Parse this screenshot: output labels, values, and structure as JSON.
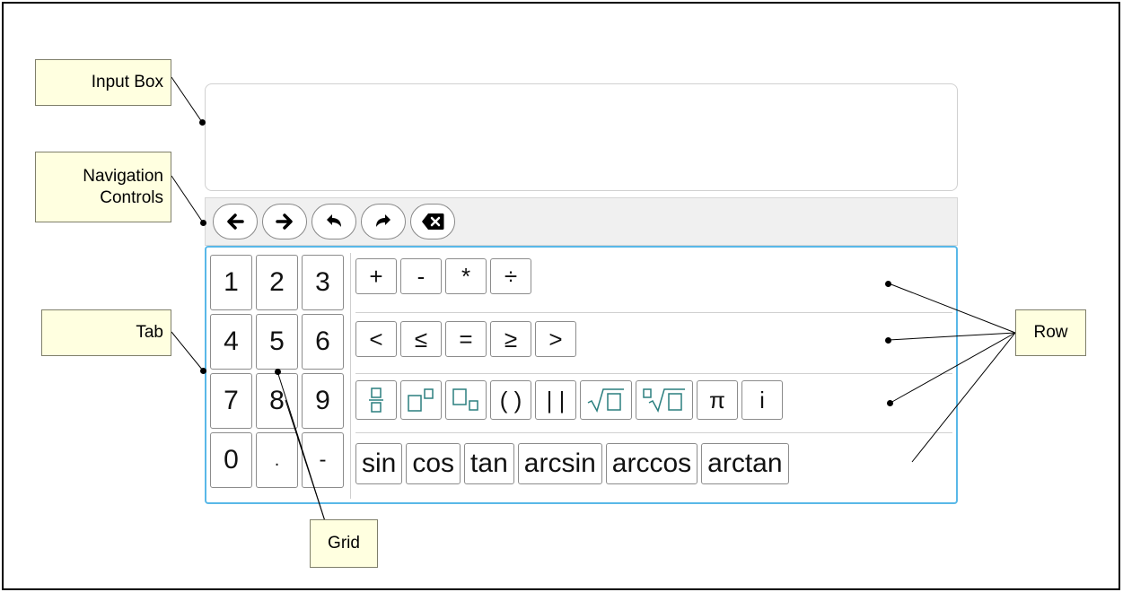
{
  "callouts": {
    "input_box": "Input Box",
    "navigation_line1": "Navigation",
    "navigation_line2": "Controls",
    "tab": "Tab",
    "row": "Row",
    "grid": "Grid"
  },
  "nav_controls": [
    {
      "icon": "arrow-left-icon"
    },
    {
      "icon": "arrow-right-icon"
    },
    {
      "icon": "undo-icon"
    },
    {
      "icon": "redo-icon"
    },
    {
      "icon": "backspace-icon"
    }
  ],
  "number_grid": [
    "1",
    "2",
    "3",
    "4",
    "5",
    "6",
    "7",
    "8",
    "9",
    "0",
    ".",
    "-"
  ],
  "rows": {
    "operators": [
      "+",
      "-",
      "*",
      "÷"
    ],
    "comparisons": [
      "<",
      "≤",
      "=",
      "≥",
      ">"
    ],
    "structures": [
      {
        "icon": "fraction-icon"
      },
      {
        "icon": "superscript-icon"
      },
      {
        "icon": "subscript-icon"
      },
      {
        "label": "( )"
      },
      {
        "label": "| |"
      },
      {
        "icon": "square-root-icon"
      },
      {
        "icon": "nth-root-icon"
      },
      {
        "label": "π"
      },
      {
        "label": "i"
      }
    ],
    "functions": [
      "sin",
      "cos",
      "tan",
      "arcsin",
      "arccos",
      "arctan"
    ]
  },
  "colors": {
    "callout_fill": "#ffffe0",
    "keyboard_border": "#59b8e8",
    "template_icon": "#2a7f7f"
  }
}
